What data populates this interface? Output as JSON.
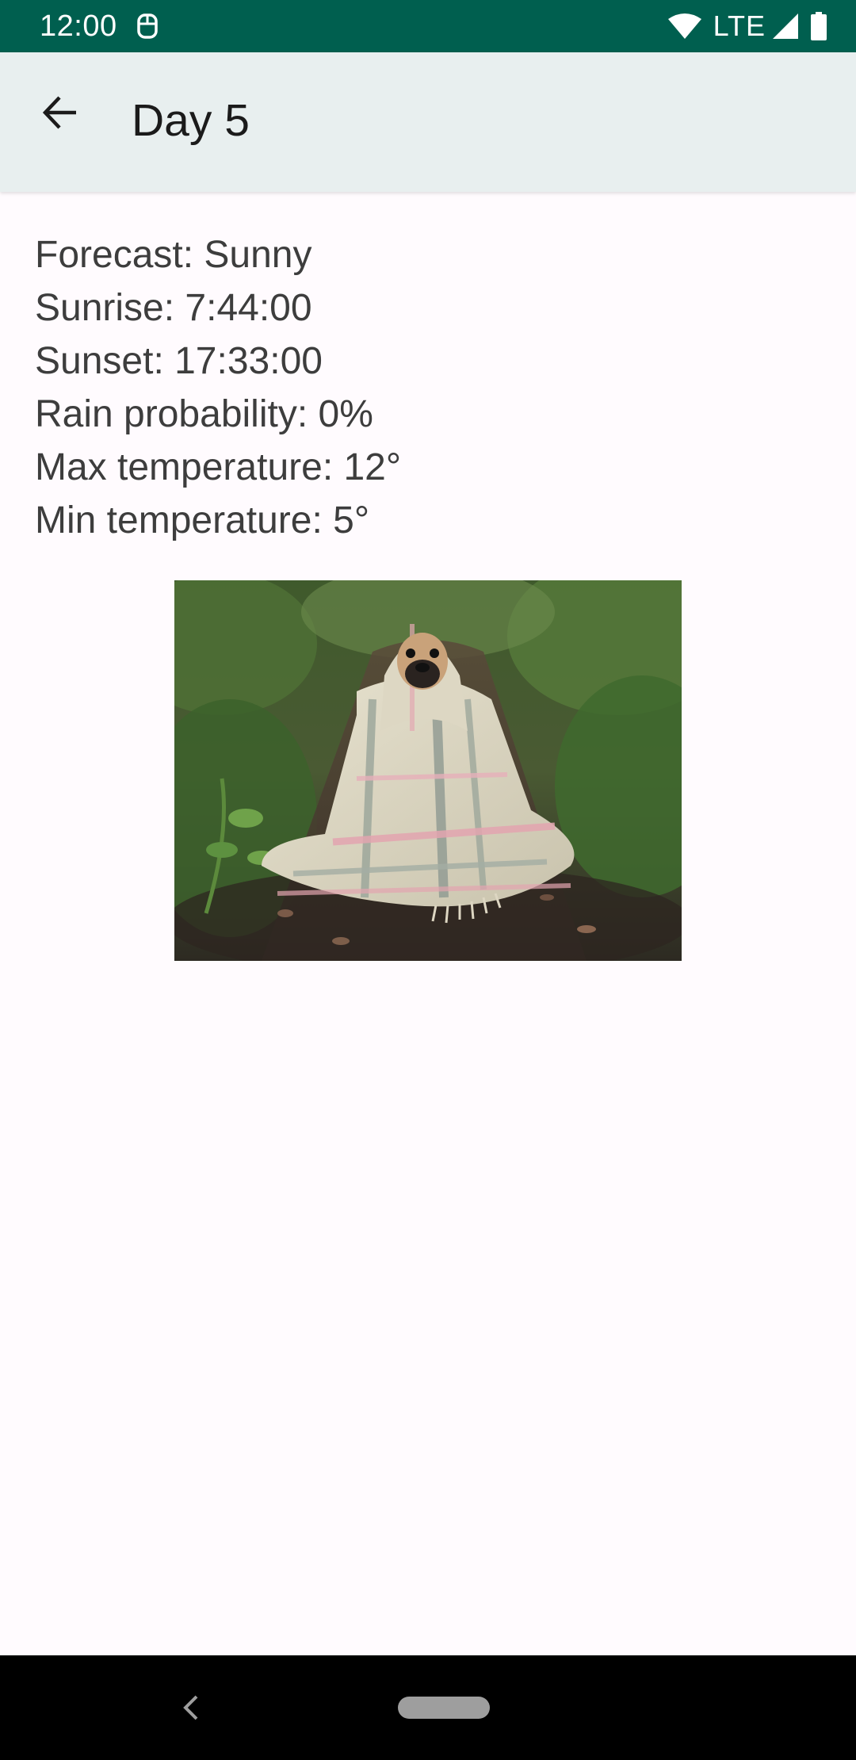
{
  "status_bar": {
    "time": "12:00",
    "network": "LTE",
    "icons": [
      "notification-icon",
      "wifi-icon",
      "signal-icon",
      "battery-icon"
    ]
  },
  "app_bar": {
    "title": "Day 5",
    "back_icon": "back-arrow-icon"
  },
  "details": [
    "Forecast: Sunny",
    "Sunrise: 7:44:00",
    "Sunset: 17:33:00",
    "Rain probability: 0%",
    "Max temperature: 12°",
    "Min temperature: 5°"
  ],
  "image": {
    "subject": "photo"
  },
  "nav_bar": {
    "icons": [
      "nav-back-icon",
      "nav-home-pill"
    ]
  },
  "colors": {
    "status_bar": "#005F4F",
    "app_bar": "#E8EFEF",
    "background": "#FFFBFE",
    "nav_bar": "#000000"
  }
}
